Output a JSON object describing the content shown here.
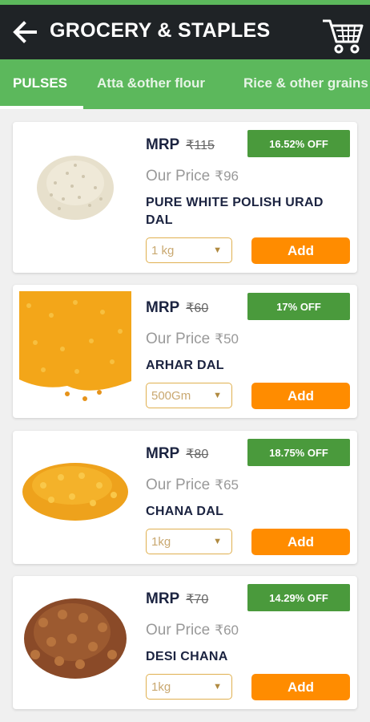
{
  "header": {
    "title": "GROCERY & STAPLES"
  },
  "tabs": [
    {
      "label": "PULSES"
    },
    {
      "label": "Atta &other flour"
    },
    {
      "label": "Rice & other grains"
    }
  ],
  "colors": {
    "header_bg": "#1f2326",
    "accent_green": "#5cb85c",
    "discount_green": "#4a9a3c",
    "add_orange": "#ff8c00"
  },
  "products": [
    {
      "mrp_label": "MRP",
      "mrp": "₹115",
      "discount": "16.52% OFF",
      "our_price_label": "Our Price",
      "our_price": "₹96",
      "name": "PURE WHITE POLISH URAD DAL",
      "unit": "1 kg",
      "add_label": "Add"
    },
    {
      "mrp_label": "MRP",
      "mrp": "₹60",
      "discount": "17% OFF",
      "our_price_label": "Our Price",
      "our_price": "₹50",
      "name": "ARHAR  DAL",
      "unit": "500Gm",
      "add_label": "Add"
    },
    {
      "mrp_label": "MRP",
      "mrp": "₹80",
      "discount": "18.75% OFF",
      "our_price_label": "Our Price",
      "our_price": "₹65",
      "name": "CHANA DAL",
      "unit": "1kg",
      "add_label": "Add"
    },
    {
      "mrp_label": "MRP",
      "mrp": "₹70",
      "discount": "14.29% OFF",
      "our_price_label": "Our Price",
      "our_price": "₹60",
      "name": "DESI CHANA",
      "unit": "1kg",
      "add_label": "Add"
    }
  ]
}
